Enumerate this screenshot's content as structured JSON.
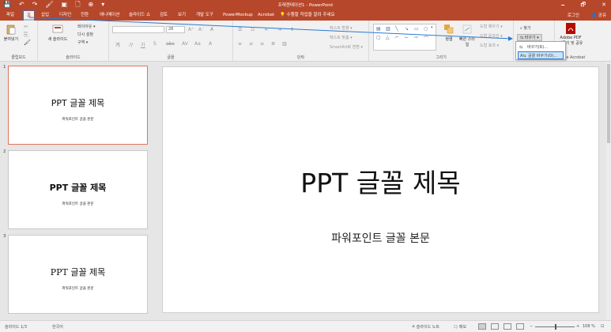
{
  "app": {
    "window_title": "프레젠테이션1 - PowerPoint",
    "window_controls": [
      "🗕",
      "🗗",
      "✕"
    ],
    "quick_access": [
      "💾",
      "↶",
      "↷",
      "🖌",
      "▣",
      "🗋",
      "⊕",
      "▾"
    ]
  },
  "tabs": [
    {
      "label": "파일"
    },
    {
      "label": "홈"
    },
    {
      "label": "삽입"
    },
    {
      "label": "디자인"
    },
    {
      "label": "전환"
    },
    {
      "label": "애니메이션"
    },
    {
      "label": "슬라이드 쇼"
    },
    {
      "label": "검토"
    },
    {
      "label": "보기"
    },
    {
      "label": "개발 도구"
    },
    {
      "label": "PowerMockup"
    },
    {
      "label": "Acrobat"
    },
    {
      "label": "💡 수행할 작업을 알려 주세요"
    }
  ],
  "account": {
    "signin": "로그인",
    "share": "👤 공유"
  },
  "ribbon": {
    "groups": {
      "clipboard": "클립보드",
      "slides": "슬라이드",
      "font": "글꼴",
      "paragraph": "단락",
      "drawing": "그리기",
      "acrobat": "Adobe Acrobat"
    },
    "paste_label": "붙여넣기",
    "new_slide_label": "새 슬라이드",
    "layout_label": "레이아웃 ▾",
    "reset_label": "다시 설정",
    "section_label": "구역 ▾",
    "font_size": "28",
    "text_direction": "텍스트 방향 ▾",
    "align_text": "텍스트 맞춤 ▾",
    "smartart": "SmartArt로 변환 ▾",
    "arrange": "정렬",
    "quick_styles": "빠른 스타일",
    "shape_fill": "도형 채우기 ▾",
    "shape_outline": "도형 윤곽선 ▾",
    "shape_effects": "도형 효과 ▾",
    "find": "찾기",
    "replace": "바꾸기 ▾",
    "adobe_pdf": "Adobe PDF",
    "create_share": "만들기 및 공유"
  },
  "replace_menu": {
    "items": [
      {
        "label": "바꾸기(R)..."
      },
      {
        "label": "글꼴 바꾸기(O)..."
      }
    ]
  },
  "thumbnails": [
    {
      "number": "1",
      "title": "PPT 글꼴 제목",
      "body": "파워포인트 글꼴 본문"
    },
    {
      "number": "2",
      "title": "PPT 글꼴 제목",
      "body": "파워포인트 글꼴 본문"
    },
    {
      "number": "3",
      "title": "PPT 글꼴 제목",
      "body": "파워포인트 글꼴 본문"
    }
  ],
  "slide": {
    "title": "PPT 글꼴 제목",
    "body": "파워포인트 글꼴 본문"
  },
  "status": {
    "slide_counter": "슬라이드 1/3",
    "language": "한국어",
    "notes": "≜ 슬라이드 노트",
    "comments": "🗨 메모",
    "zoom": "108 %"
  },
  "colors": {
    "accent": "#b7472a",
    "ribbon_bg": "#f1f1f1",
    "arrow": "#2b79d4"
  }
}
